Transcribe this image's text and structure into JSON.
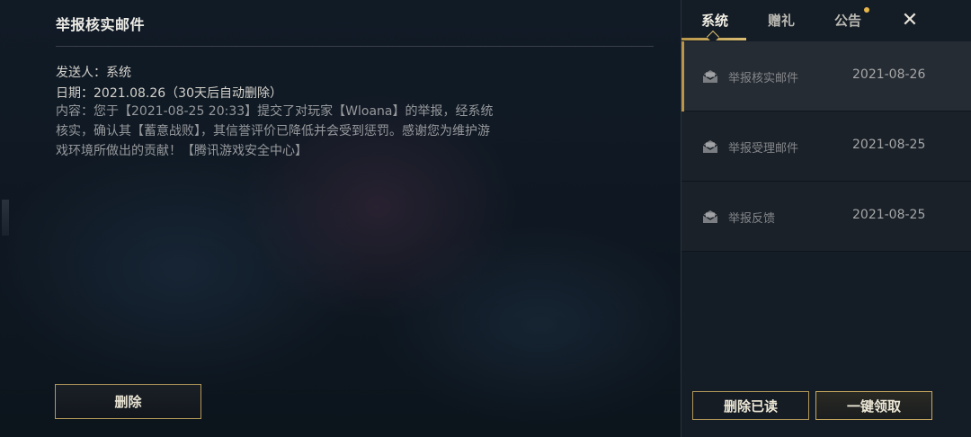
{
  "mail": {
    "title": "举报核实邮件",
    "sender": "发送人：系统",
    "date": "日期：2021.08.26（30天后自动删除）",
    "content": "内容：您于【2021-08-25 20:33】提交了对玩家【Wloana】的举报，经系统核实，确认其【蓄意战败】，其信誉评价已降低并会受到惩罚。感谢您为维护游戏环境所做出的贡献！【腾讯游戏安全中心】",
    "delete_label": "删除"
  },
  "tabs": [
    {
      "label": "系统",
      "active": true
    },
    {
      "label": "赠礼",
      "active": false
    },
    {
      "label": "公告",
      "active": false
    }
  ],
  "close_label": "✕",
  "mail_list": [
    {
      "name": "举报核实邮件",
      "date": "2021-08-26",
      "selected": true
    },
    {
      "name": "举报受理邮件",
      "date": "2021-08-25",
      "selected": false
    },
    {
      "name": "举报反馈",
      "date": "2021-08-25",
      "selected": false
    }
  ],
  "actions": {
    "delete_read_label": "删除已读",
    "claim_all_label": "一键领取"
  },
  "colors": {
    "accent_gold": "#b9964a",
    "background": "#0d141c",
    "panel": "#141c25"
  },
  "icons": {
    "mail": "mail-envelope-icon",
    "close": "close-icon"
  }
}
